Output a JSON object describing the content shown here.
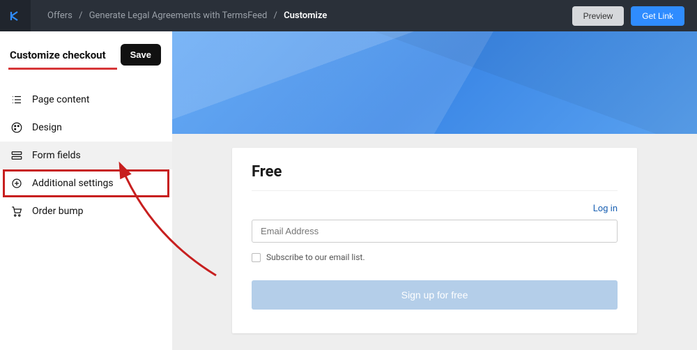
{
  "header": {
    "breadcrumb": [
      "Offers",
      "Generate Legal Agreements with TermsFeed",
      "Customize"
    ],
    "preview": "Preview",
    "get_link": "Get Link"
  },
  "sidebar": {
    "title": "Customize checkout",
    "save": "Save",
    "items": [
      {
        "label": "Page content"
      },
      {
        "label": "Design"
      },
      {
        "label": "Form fields"
      },
      {
        "label": "Additional settings"
      },
      {
        "label": "Order bump"
      }
    ]
  },
  "card": {
    "title": "Free",
    "login": "Log in",
    "email_placeholder": "Email Address",
    "subscribe": "Subscribe to our email list.",
    "signup": "Sign up for free"
  }
}
